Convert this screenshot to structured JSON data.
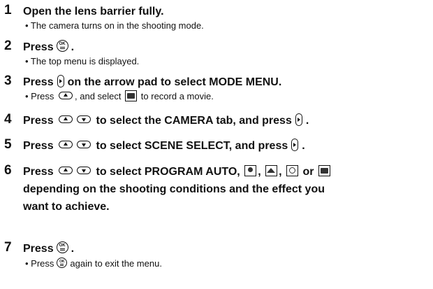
{
  "steps": [
    {
      "number": "1",
      "title": "Open the lens barrier fully.",
      "notes": [
        "• The camera turns on in the shooting mode."
      ]
    },
    {
      "number": "2",
      "title": "Press",
      "title_end": ".",
      "notes": [
        "• The top menu is displayed."
      ]
    },
    {
      "number": "3",
      "title_pre": "Press",
      "title_post": "on the arrow pad to select MODE MENU.",
      "note_pre": "• Press",
      "note_mid": ", and select",
      "note_post": "to record a movie."
    },
    {
      "number": "4",
      "title_pre": "Press",
      "title_mid": "to select the CAMERA tab, and press",
      "title_end": "."
    },
    {
      "number": "5",
      "title_pre": "Press",
      "title_mid": "to select SCENE SELECT, and press",
      "title_end": "."
    },
    {
      "number": "6",
      "title_pre": "Press",
      "title_mid": "to select PROGRAM AUTO,",
      "sep1": ",",
      "sep2": ",",
      "sep3": "or",
      "line2": "depending on the shooting conditions and the effect you",
      "line3": "want to achieve."
    },
    {
      "number": "7",
      "title": "Press",
      "title_end": ".",
      "note_pre": "• Press",
      "note_post": "again to exit the menu."
    }
  ],
  "icons": {
    "ok_button": "ok-menu-button-icon",
    "arrow_right": "arrow-pad-right-icon",
    "arrow_up": "arrow-pad-up-icon",
    "arrow_down": "arrow-pad-down-icon",
    "movie": "movie-mode-icon",
    "portrait": "portrait-scene-icon",
    "landscape": "landscape-scene-icon",
    "night": "night-scene-icon",
    "landscape_portrait": "landscape-portrait-scene-icon"
  },
  "ok_label": "OK"
}
